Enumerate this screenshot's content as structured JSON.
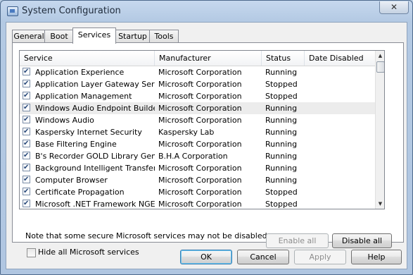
{
  "window": {
    "title": "System Configuration",
    "close_glyph": "✕"
  },
  "tabs": [
    {
      "label": "General"
    },
    {
      "label": "Boot"
    },
    {
      "label": "Services"
    },
    {
      "label": "Startup"
    },
    {
      "label": "Tools"
    }
  ],
  "active_tab": "Services",
  "services_table": {
    "columns": [
      "Service",
      "Manufacturer",
      "Status",
      "Date Disabled"
    ],
    "rows": [
      {
        "checked": true,
        "service": "Application Experience",
        "manufacturer": "Microsoft Corporation",
        "status": "Running",
        "date_disabled": ""
      },
      {
        "checked": true,
        "service": "Application Layer Gateway Service",
        "manufacturer": "Microsoft Corporation",
        "status": "Stopped",
        "date_disabled": ""
      },
      {
        "checked": true,
        "service": "Application Management",
        "manufacturer": "Microsoft Corporation",
        "status": "Stopped",
        "date_disabled": ""
      },
      {
        "checked": true,
        "service": "Windows Audio Endpoint Builder",
        "manufacturer": "Microsoft Corporation",
        "status": "Running",
        "date_disabled": ""
      },
      {
        "checked": true,
        "service": "Windows Audio",
        "manufacturer": "Microsoft Corporation",
        "status": "Running",
        "date_disabled": ""
      },
      {
        "checked": true,
        "service": "Kaspersky Internet Security",
        "manufacturer": "Kaspersky Lab",
        "status": "Running",
        "date_disabled": ""
      },
      {
        "checked": true,
        "service": "Base Filtering Engine",
        "manufacturer": "Microsoft Corporation",
        "status": "Running",
        "date_disabled": ""
      },
      {
        "checked": true,
        "service": "B's Recorder GOLD Library Gene...",
        "manufacturer": "B.H.A Corporation",
        "status": "Running",
        "date_disabled": ""
      },
      {
        "checked": true,
        "service": "Background Intelligent Transfer ...",
        "manufacturer": "Microsoft Corporation",
        "status": "Running",
        "date_disabled": ""
      },
      {
        "checked": true,
        "service": "Computer Browser",
        "manufacturer": "Microsoft Corporation",
        "status": "Running",
        "date_disabled": ""
      },
      {
        "checked": true,
        "service": "Certificate Propagation",
        "manufacturer": "Microsoft Corporation",
        "status": "Stopped",
        "date_disabled": ""
      },
      {
        "checked": true,
        "service": "Microsoft .NET Framework NGEN...",
        "manufacturer": "Microsoft Corporation",
        "status": "Stopped",
        "date_disabled": ""
      }
    ]
  },
  "note": "Note that some secure Microsoft services may not be disabled.",
  "enable_all_label": "Enable all",
  "disable_all_label": "Disable all",
  "hide_microsoft": {
    "label": "Hide all Microsoft services",
    "checked": false
  },
  "footer": {
    "ok": "OK",
    "cancel": "Cancel",
    "apply": "Apply",
    "help": "Help"
  },
  "colors": {
    "title_bar": "#b9cde6",
    "selected_row": "#ececec",
    "accent_border": "#3c7fb1"
  }
}
